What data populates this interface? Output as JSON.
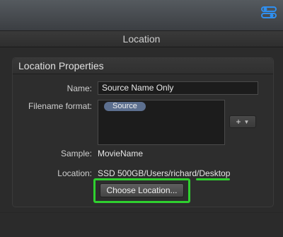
{
  "header": {
    "title": "Location"
  },
  "panel": {
    "title": "Location Properties"
  },
  "fields": {
    "name_label": "Name:",
    "name_value": "Source Name Only",
    "format_label": "Filename format:",
    "format_token": "Source",
    "add_button_label": "+",
    "sample_label": "Sample:",
    "sample_value": "MovieName",
    "location_label": "Location:",
    "location_value": "SSD 500GB/Users/richard/Desktop"
  },
  "buttons": {
    "choose_location": "Choose Location..."
  },
  "icons": {
    "inspector": "inspector-sliders-icon",
    "add_menu_arrow": "chevron-down-icon"
  },
  "colors": {
    "highlight": "#2fd02f",
    "token": "#5c6f8f",
    "inspector_icon": "#2f8ff0"
  }
}
